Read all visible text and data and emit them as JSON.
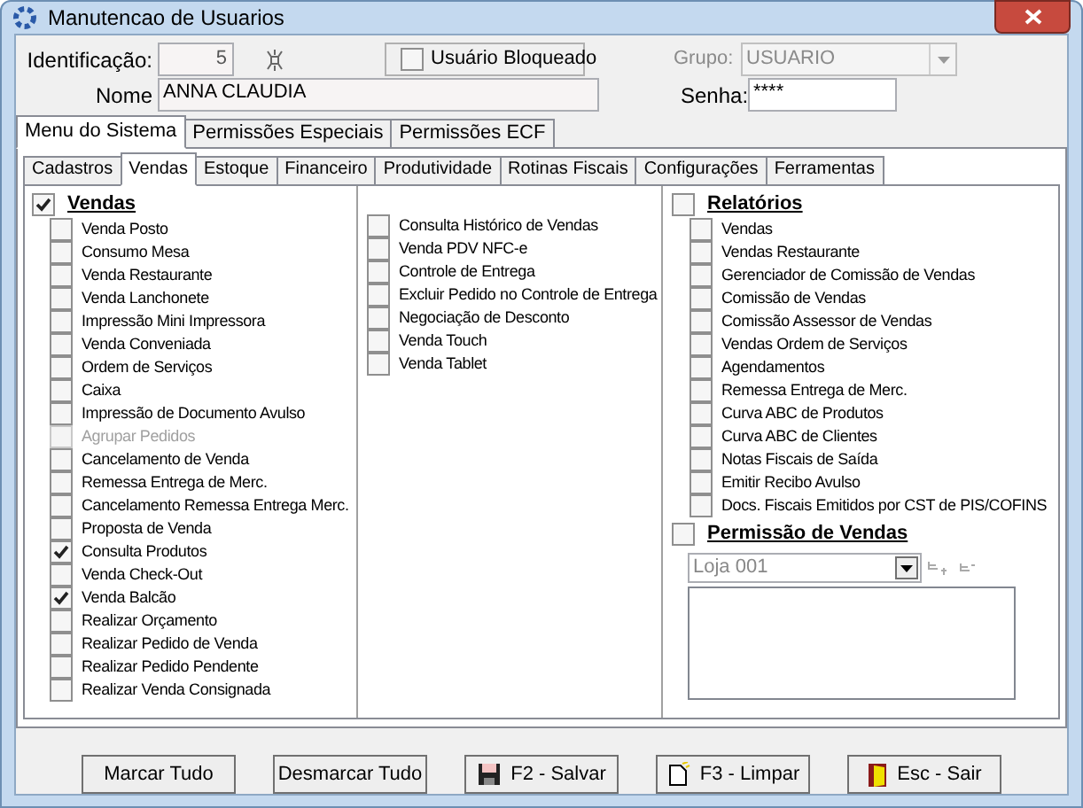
{
  "window": {
    "title": "Manutencao de Usuarios"
  },
  "identificacao": {
    "label": "Identificação:",
    "value": "5"
  },
  "usuario_bloqueado": {
    "label": "Usuário Bloqueado",
    "checked": false
  },
  "grupo": {
    "label": "Grupo:",
    "value": "USUARIO",
    "disabled": true
  },
  "nome": {
    "label": "Nome",
    "value": "ANNA CLAUDIA"
  },
  "senha": {
    "label": "Senha:",
    "value": "****"
  },
  "outer_tabs": [
    {
      "label": "Menu do Sistema",
      "selected": true
    },
    {
      "label": "Permissões Especiais",
      "selected": false
    },
    {
      "label": "Permissões ECF",
      "selected": false
    }
  ],
  "inner_tabs": [
    {
      "label": "Cadastros",
      "selected": false
    },
    {
      "label": "Vendas",
      "selected": true
    },
    {
      "label": "Estoque",
      "selected": false
    },
    {
      "label": "Financeiro",
      "selected": false
    },
    {
      "label": "Produtividade",
      "selected": false
    },
    {
      "label": "Rotinas Fiscais",
      "selected": false
    },
    {
      "label": "Configurações",
      "selected": false
    },
    {
      "label": "Ferramentas",
      "selected": false
    }
  ],
  "vendas": {
    "label": "Vendas",
    "checked": true,
    "items": [
      {
        "label": "Venda Posto",
        "checked": false,
        "disabled": false
      },
      {
        "label": "Consumo Mesa",
        "checked": false,
        "disabled": false
      },
      {
        "label": "Venda Restaurante",
        "checked": false,
        "disabled": false
      },
      {
        "label": "Venda Lanchonete",
        "checked": false,
        "disabled": false
      },
      {
        "label": "Impressão Mini Impressora",
        "checked": false,
        "disabled": false
      },
      {
        "label": "Venda Conveniada",
        "checked": false,
        "disabled": false
      },
      {
        "label": "Ordem de Serviços",
        "checked": false,
        "disabled": false
      },
      {
        "label": "Caixa",
        "checked": false,
        "disabled": false
      },
      {
        "label": "Impressão de Documento Avulso",
        "checked": false,
        "disabled": false
      },
      {
        "label": "Agrupar Pedidos",
        "checked": false,
        "disabled": true
      },
      {
        "label": "Cancelamento de Venda",
        "checked": false,
        "disabled": false
      },
      {
        "label": "Remessa Entrega de Merc.",
        "checked": false,
        "disabled": false
      },
      {
        "label": "Cancelamento Remessa Entrega Merc.",
        "checked": false,
        "disabled": false
      },
      {
        "label": "Proposta de Venda",
        "checked": false,
        "disabled": false
      },
      {
        "label": "Consulta Produtos",
        "checked": true,
        "disabled": false
      },
      {
        "label": "Venda Check-Out",
        "checked": false,
        "disabled": false
      },
      {
        "label": "Venda Balcão",
        "checked": true,
        "disabled": false
      },
      {
        "label": "Realizar Orçamento",
        "checked": false,
        "disabled": false
      },
      {
        "label": "Realizar Pedido de Venda",
        "checked": false,
        "disabled": false
      },
      {
        "label": "Realizar Pedido Pendente",
        "checked": false,
        "disabled": false
      },
      {
        "label": "Realizar Venda Consignada",
        "checked": false,
        "disabled": false
      }
    ]
  },
  "column_2": [
    {
      "label": "Consulta Histórico de Vendas",
      "checked": false
    },
    {
      "label": "Venda PDV NFC-e",
      "checked": false
    },
    {
      "label": "Controle de Entrega",
      "checked": false
    },
    {
      "label": "Excluir Pedido no Controle de Entrega",
      "checked": false
    },
    {
      "label": "Negociação de Desconto",
      "checked": false
    },
    {
      "label": "Venda Touch",
      "checked": false
    },
    {
      "label": "Venda Tablet",
      "checked": false
    }
  ],
  "relatorios": {
    "label": "Relatórios",
    "checked": false,
    "items": [
      {
        "label": "Vendas",
        "checked": false
      },
      {
        "label": "Vendas Restaurante",
        "checked": false
      },
      {
        "label": "Gerenciador de Comissão de Vendas",
        "checked": false
      },
      {
        "label": "Comissão de Vendas",
        "checked": false
      },
      {
        "label": "Comissão Assessor de Vendas",
        "checked": false
      },
      {
        "label": "Vendas Ordem de Serviços",
        "checked": false
      },
      {
        "label": "Agendamentos",
        "checked": false
      },
      {
        "label": "Remessa Entrega de Merc.",
        "checked": false
      },
      {
        "label": "Curva ABC de Produtos",
        "checked": false
      },
      {
        "label": "Curva ABC de Clientes",
        "checked": false
      },
      {
        "label": "Notas Fiscais de Saída",
        "checked": false
      },
      {
        "label": "Emitir Recibo Avulso",
        "checked": false
      },
      {
        "label": "Docs. Fiscais Emitidos por CST de PIS/COFINS",
        "checked": false
      }
    ]
  },
  "permissao_vendas": {
    "label": "Permissão de Vendas",
    "checked": false,
    "store": "Loja 001"
  },
  "buttons": [
    {
      "label": "Marcar Tudo",
      "kind": "plain"
    },
    {
      "label": "Desmarcar Tudo",
      "kind": "plain"
    },
    {
      "label": "F2 - Salvar",
      "kind": "save"
    },
    {
      "label": "F3 - Limpar",
      "kind": "clear"
    },
    {
      "label": "Esc - Sair",
      "kind": "exit"
    }
  ]
}
